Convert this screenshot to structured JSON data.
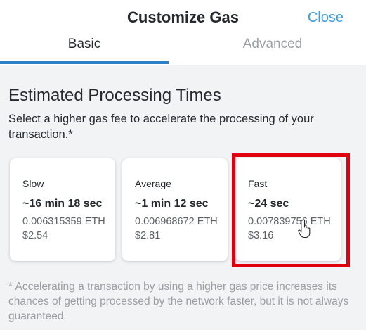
{
  "header": {
    "title": "Customize Gas",
    "close_label": "Close"
  },
  "tabs": [
    {
      "label": "Basic",
      "active": true
    },
    {
      "label": "Advanced",
      "active": false
    }
  ],
  "section": {
    "heading": "Estimated Processing Times",
    "description": "Select a higher gas fee to accelerate the processing of your transaction.*"
  },
  "options": [
    {
      "label": "Slow",
      "time": "~16 min 18 sec",
      "eth": "0.006315359 ETH",
      "usd": "$2.54",
      "highlighted": false
    },
    {
      "label": "Average",
      "time": "~1 min 12 sec",
      "eth": "0.006968672 ETH",
      "usd": "$2.81",
      "highlighted": false
    },
    {
      "label": "Fast",
      "time": "~24 sec",
      "eth": "0.007839756 ETH",
      "usd": "$3.16",
      "highlighted": true
    }
  ],
  "footnote": "* Accelerating a transaction by using a higher gas price increases its chances of getting processed by the network faster, but it is not always guaranteed.",
  "icons": {
    "cursor": "hand-pointer-icon"
  },
  "colors": {
    "accent": "#3c9fe3",
    "tab_underline": "#2f80c4",
    "highlight": "#e3000e"
  }
}
